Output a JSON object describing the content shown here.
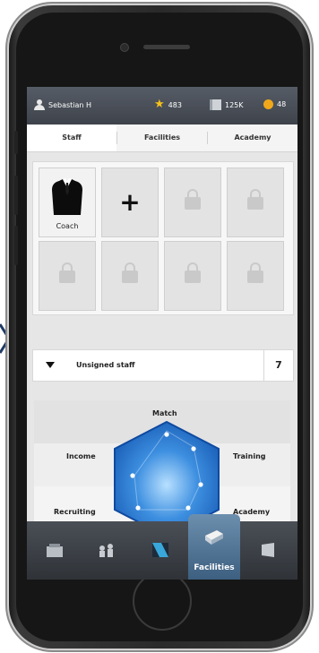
{
  "colors": {
    "accent": "#2a6fc7",
    "gold": "#f3c21b",
    "bar_dark": "#3e434b"
  },
  "topbar": {
    "username": "Sebastian H",
    "stars": "483",
    "cards": "125K",
    "coins": "48"
  },
  "tabs": [
    {
      "label": "Staff",
      "active": true
    },
    {
      "label": "Facilities",
      "active": false
    },
    {
      "label": "Academy",
      "active": false
    }
  ],
  "staff_slots": {
    "coach_label": "Coach",
    "add_symbol": "+",
    "icons": [
      "suit-icon",
      "plus-icon",
      "lock-icon"
    ]
  },
  "unsigned_staff": {
    "label": "Unsigned staff",
    "count": "7"
  },
  "radar": {
    "labels": {
      "top": "Match",
      "left": "Income",
      "right": "Training",
      "bottom_left": "Recruiting",
      "bottom_right": "Academy"
    }
  },
  "bottom_nav": {
    "items": [
      {
        "name": "stadium",
        "icon": "stadium-icon"
      },
      {
        "name": "team",
        "icon": "team-icon"
      },
      {
        "name": "kit",
        "icon": "kit-icon"
      },
      {
        "name": "facilities",
        "label": "Facilities",
        "icon": "facilities-icon",
        "active": true
      },
      {
        "name": "shop",
        "icon": "shop-icon"
      }
    ],
    "active_label": "Facilities"
  }
}
